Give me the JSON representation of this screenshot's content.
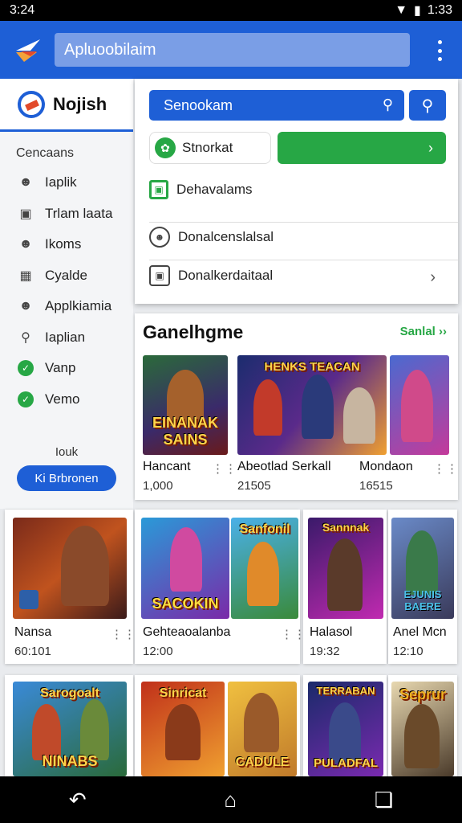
{
  "status": {
    "time": "3:24",
    "clock_right": "1:33"
  },
  "appbar": {
    "search_text": "Apluoobilaim"
  },
  "sidebar": {
    "brand": "Nojish",
    "heading": "Cencaans",
    "items": [
      {
        "label": "Iaplik",
        "icon": "person-icon"
      },
      {
        "label": "Trlam laata",
        "icon": "image-icon"
      },
      {
        "label": "Ikoms",
        "icon": "person-icon"
      },
      {
        "label": "Cyalde",
        "icon": "map-icon"
      },
      {
        "label": "Applkiamia",
        "icon": "person-icon"
      },
      {
        "label": "Iaplian",
        "icon": "search-icon"
      },
      {
        "label": "Vanp",
        "icon": "check-circle-icon"
      },
      {
        "label": "Vemo",
        "icon": "check-circle-icon"
      }
    ],
    "footer_label": "Iouk",
    "footer_button": "Ki Brbronen"
  },
  "panel": {
    "search_text": "Senookam",
    "pill_label": "Stnorkat",
    "row1": "Dehavalams",
    "row2": "Donalcenslalsal",
    "row3": "Donalkerdaitaal"
  },
  "games": {
    "title": "Ganelhgme",
    "see_all": "Sanlal",
    "row1": [
      {
        "name": "Hancant",
        "count": "1,000",
        "art_title": "EINANAK SAINS"
      },
      {
        "name": "Abeotlad Serkall",
        "count": "21505",
        "art_title": "HENKS TEACAN"
      },
      {
        "name": "Mondaon",
        "count": "16515",
        "art_title": ""
      }
    ],
    "row2": [
      {
        "name": "Nansa",
        "count": "60:101",
        "art_title": ""
      },
      {
        "name": "Gehteaoalanba",
        "count": "12:00",
        "art_title": "SACOKIN"
      },
      {
        "name": "Halasol",
        "count": "19:32",
        "art_title": "Sannnak"
      },
      {
        "name": "Anel Mcn",
        "count": "12:10",
        "art_title": "EJUNIS BAERE"
      }
    ],
    "row3": [
      {
        "art_title": "NINABS"
      },
      {
        "art_title": "CADULE"
      },
      {
        "art_title": "PULADFAL"
      },
      {
        "art_title": "Seprur"
      }
    ],
    "row2_art_top_labels": [
      "Sanfonil",
      "Sannnak"
    ],
    "row3_art_top_labels": [
      "Sarogoalt",
      "Sinricat",
      "TERRABAN"
    ]
  },
  "colors": {
    "primary": "#1e5fd6",
    "green": "#27a745"
  }
}
